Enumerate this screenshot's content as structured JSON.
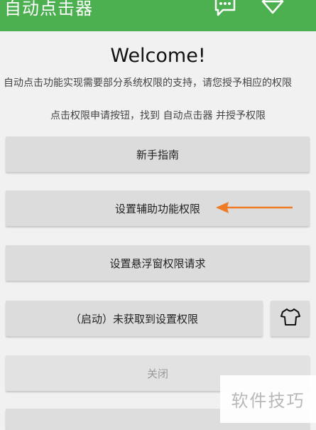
{
  "appbar": {
    "title": "自动点击器",
    "accent": "#4caf50",
    "actions": [
      "chat-icon",
      "diamond-icon"
    ]
  },
  "welcome": "Welcome!",
  "notice": "自动点击功能实现需要部分系统权限的支持，请您授予相应的权限",
  "hint": "点击权限申请按钮，找到 自动点击器 并授予权限",
  "buttons": {
    "guide": "新手指南",
    "accessibility": "设置辅助功能权限",
    "float": "设置悬浮窗权限请求",
    "start": "（启动）未获取到设置权限",
    "skin_icon": "tshirt-icon",
    "close": "关闭"
  },
  "annotation": {
    "arrow_color": "#f07b26"
  },
  "watermark": "软件技巧"
}
